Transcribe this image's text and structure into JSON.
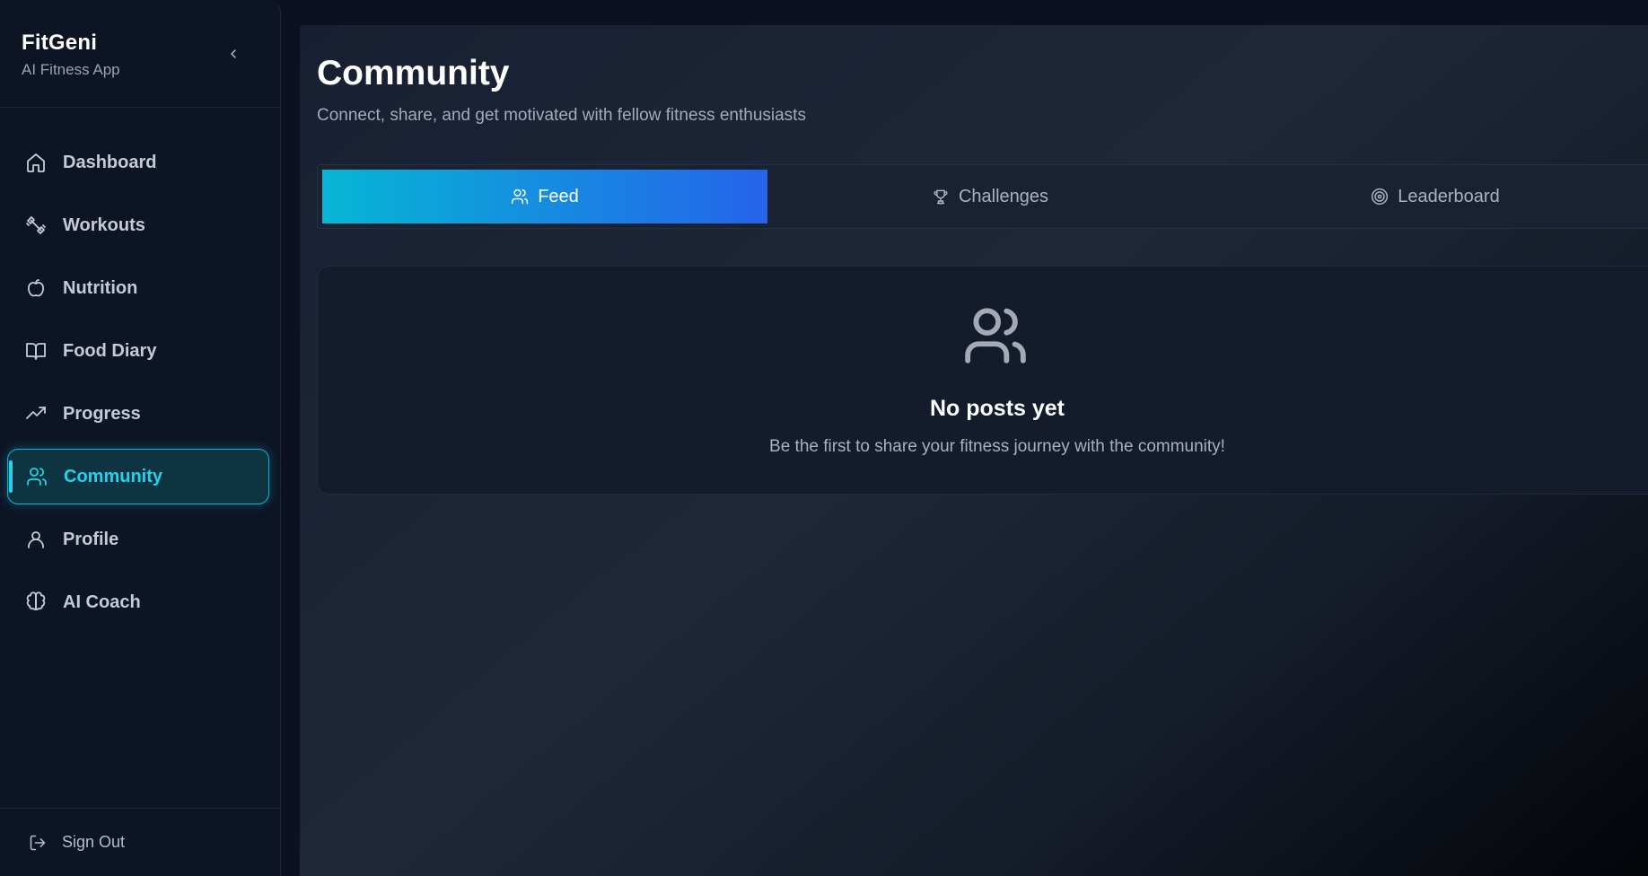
{
  "app": {
    "title": "FitGeni",
    "subtitle": "AI Fitness App"
  },
  "sidebar": {
    "items": [
      {
        "label": "Dashboard",
        "icon": "home-icon",
        "active": false
      },
      {
        "label": "Workouts",
        "icon": "dumbbell-icon",
        "active": false
      },
      {
        "label": "Nutrition",
        "icon": "apple-icon",
        "active": false
      },
      {
        "label": "Food Diary",
        "icon": "book-icon",
        "active": false
      },
      {
        "label": "Progress",
        "icon": "trending-up-icon",
        "active": false
      },
      {
        "label": "Community",
        "icon": "users-icon",
        "active": true
      },
      {
        "label": "Profile",
        "icon": "user-icon",
        "active": false
      },
      {
        "label": "AI Coach",
        "icon": "brain-icon",
        "active": false
      }
    ],
    "sign_out": "Sign Out"
  },
  "main": {
    "title": "Community",
    "subtitle": "Connect, share, and get motivated with fellow fitness enthusiasts",
    "tabs": [
      {
        "label": "Feed",
        "icon": "users-icon",
        "active": true
      },
      {
        "label": "Challenges",
        "icon": "trophy-icon",
        "active": false
      },
      {
        "label": "Leaderboard",
        "icon": "target-icon",
        "active": false
      }
    ],
    "empty_state": {
      "icon": "users-icon",
      "title": "No posts yet",
      "text": "Be the first to share your fitness journey with the community!"
    }
  },
  "colors": {
    "accent": "#22d3ee",
    "tab_gradient_start": "#06b6d4",
    "tab_gradient_end": "#2563eb",
    "background": "#0b1120"
  }
}
